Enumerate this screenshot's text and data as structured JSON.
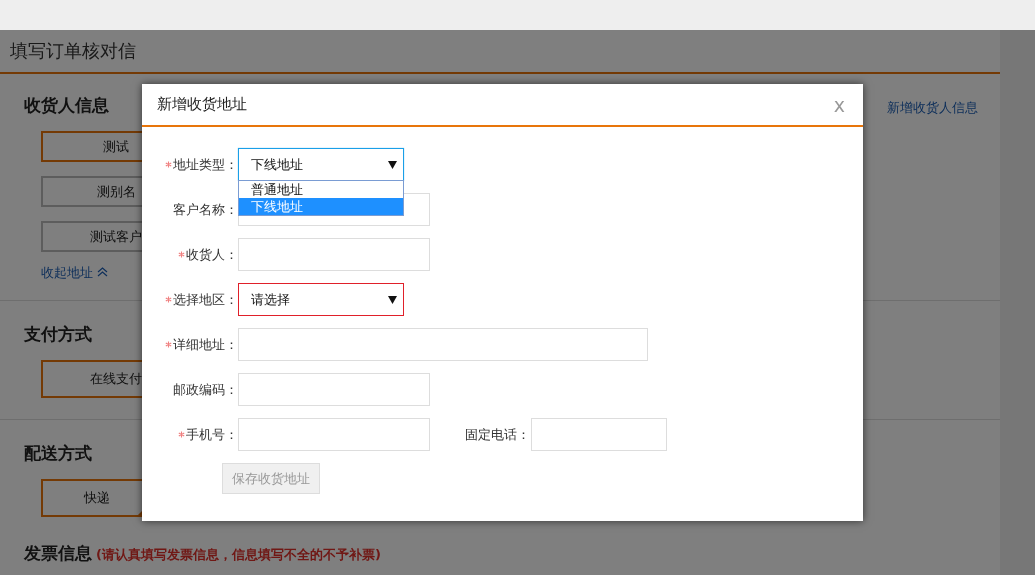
{
  "page": {
    "title": "填写订单核对信",
    "add_link": "新增收货人信息",
    "sections": [
      {
        "heading": "收货人信息",
        "options": [
          {
            "label": "测试",
            "selected": true
          },
          {
            "label": "测别名",
            "selected": false
          },
          {
            "label": "测试客户",
            "selected": false
          }
        ],
        "collapse_link": "收起地址"
      },
      {
        "heading": "支付方式",
        "options": [
          {
            "label": "在线支付",
            "selected": true
          }
        ]
      },
      {
        "heading": "配送方式",
        "options": [
          {
            "label": "快递",
            "selected": true
          }
        ]
      },
      {
        "heading": "发票信息",
        "note": "(请认真填写发票信息，信息填写不全的不予补票)"
      }
    ]
  },
  "dialog": {
    "title": "新增收货地址",
    "close": "x",
    "fields": [
      {
        "kind": "select",
        "label": "地址类型：",
        "required": true,
        "value": "下线地址",
        "focused": true,
        "invalid": false,
        "options": [
          {
            "label": "普通地址",
            "selected": false
          },
          {
            "label": "下线地址",
            "selected": true
          }
        ]
      },
      {
        "kind": "text",
        "label": "客户名称：",
        "required": false
      },
      {
        "kind": "text",
        "label": "收货人：",
        "required": true
      },
      {
        "kind": "select",
        "label": "选择地区：",
        "required": true,
        "value": "请选择",
        "focused": false,
        "invalid": true
      },
      {
        "kind": "wide",
        "label": "详细地址：",
        "required": true
      },
      {
        "kind": "text",
        "label": "邮政编码：",
        "required": false
      },
      {
        "kind": "text",
        "label": "手机号：",
        "required": true,
        "extra": {
          "label": "固定电话："
        }
      }
    ],
    "save_button": {
      "label": "保存收货地址",
      "disabled": true
    }
  }
}
